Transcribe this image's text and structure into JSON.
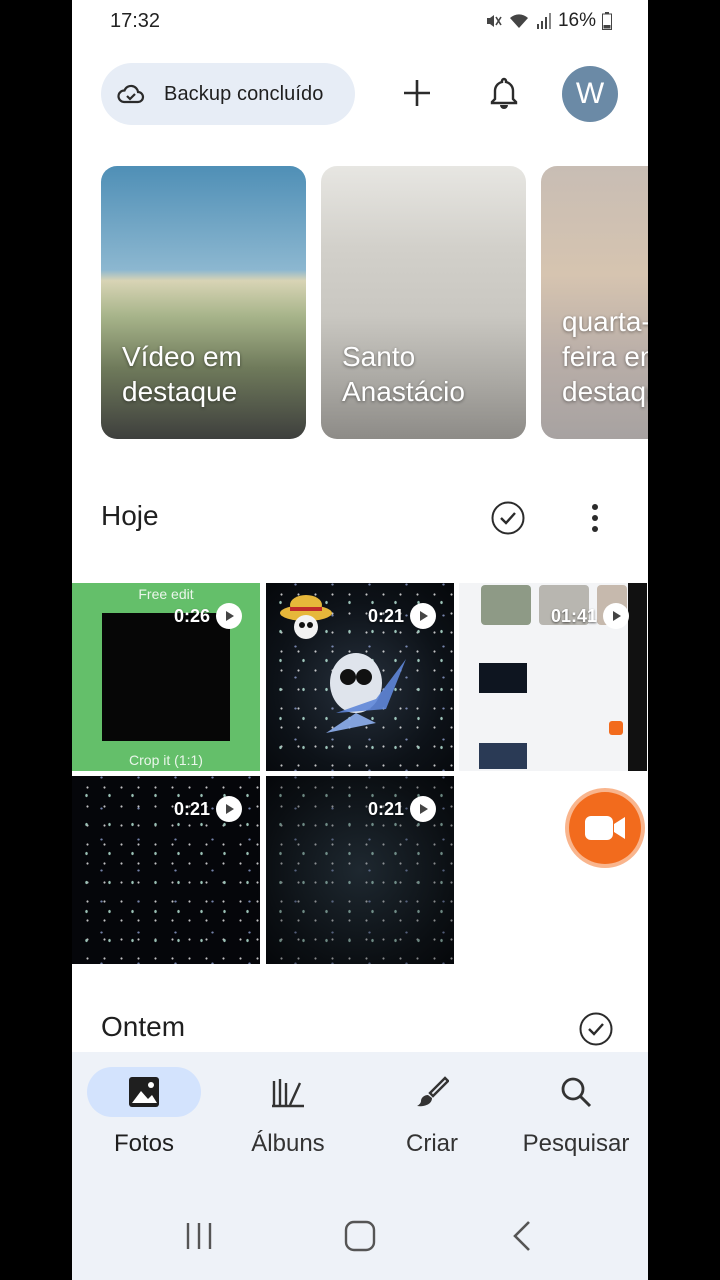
{
  "status_bar": {
    "time": "17:32",
    "battery": "16%"
  },
  "header": {
    "backup_label": "Backup concluído",
    "avatar_initial": "W"
  },
  "memories": [
    {
      "title": "Vídeo em\ndestaque"
    },
    {
      "title": "Santo\nAnastácio"
    },
    {
      "title": "quarta-\nfeira em\ndestaque"
    }
  ],
  "sections": {
    "today": "Hoje",
    "yesterday": "Ontem"
  },
  "grid": {
    "tiles": [
      {
        "duration": "0:26",
        "top_caption": "Free edit",
        "bottom_caption": "Crop it (1:1)"
      },
      {
        "duration": "0:21"
      },
      {
        "duration": "01:41"
      },
      {
        "duration": "0:21"
      },
      {
        "duration": "0:21"
      }
    ]
  },
  "bottom_nav": {
    "items": [
      {
        "label": "Fotos",
        "icon": "photo-icon",
        "active": true
      },
      {
        "label": "Álbuns",
        "icon": "albums-icon",
        "active": false
      },
      {
        "label": "Criar",
        "icon": "brush-icon",
        "active": false
      },
      {
        "label": "Pesquisar",
        "icon": "search-icon",
        "active": false
      }
    ]
  },
  "colors": {
    "accent": "#d3e3fd",
    "record": "#f26b1d",
    "chip": "#e7edf6"
  }
}
